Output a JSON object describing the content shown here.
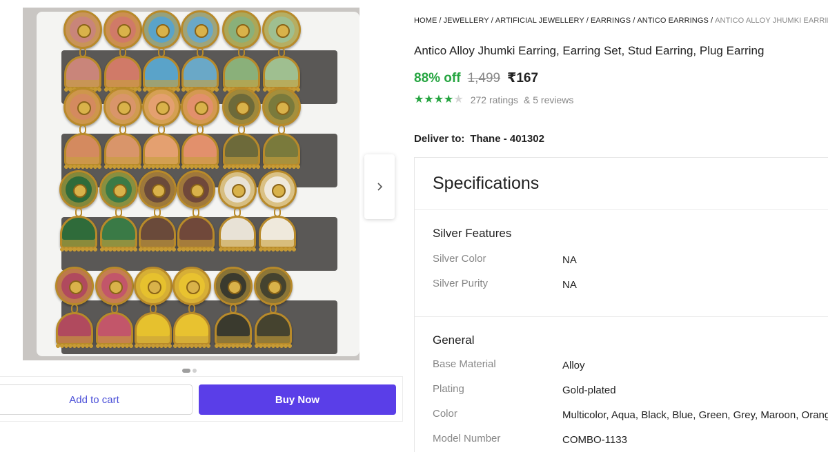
{
  "breadcrumb": {
    "items": [
      "HOME",
      "JEWELLERY",
      "ARTIFICIAL JEWELLERY",
      "EARRINGS",
      "ANTICO EARRINGS"
    ],
    "current": "ANTICO ALLOY JHUMKI EARRING, EA"
  },
  "product": {
    "title": "Antico Alloy Jhumki Earring, Earring Set, Stud Earring, Plug Earring",
    "discount": "88% off",
    "mrp": "1,499",
    "price": "₹167",
    "rating_stars": 4,
    "rating_max": 5,
    "ratings_count": "272 ratings",
    "reviews": "& 5 reviews"
  },
  "delivery": {
    "label": "Deliver to:",
    "location": "Thane - 401302"
  },
  "gallery": {
    "image_alt_icon": "product-image",
    "next_icon": "chevron-right-icon",
    "current_slide": 1,
    "total_slides": 2,
    "earring_colors": [
      [
        "#c9857a",
        "#d07a68",
        "#5aa3c9",
        "#6aa8c7",
        "#8ab07a",
        "#9fbf90"
      ],
      [
        "#d48a5f",
        "#d9956a",
        "#e4a070",
        "#e2906c",
        "#6d6a3a",
        "#7a7a3c"
      ],
      [
        "#2f6b3a",
        "#3a7a46",
        "#6a4a3a",
        "#70483a",
        "#e8e2d6",
        "#efe9dc"
      ],
      [
        "#b04a5e",
        "#c2566a",
        "#e6c12e",
        "#e8c230",
        "#3a3a2e",
        "#45432f"
      ]
    ]
  },
  "actions": {
    "add_to_cart": "Add to cart",
    "buy_now": "Buy Now"
  },
  "specifications": {
    "title": "Specifications",
    "sections": [
      {
        "name": "Silver Features",
        "rows": [
          {
            "key": "Silver Color",
            "value": "NA"
          },
          {
            "key": "Silver Purity",
            "value": "NA"
          }
        ]
      },
      {
        "name": "General",
        "rows": [
          {
            "key": "Base Material",
            "value": "Alloy"
          },
          {
            "key": "Plating",
            "value": "Gold-plated"
          },
          {
            "key": "Color",
            "value": "Multicolor, Aqua, Black, Blue, Green, Grey, Maroon, Orange,"
          },
          {
            "key": "Model Number",
            "value": "COMBO-1133"
          }
        ]
      }
    ]
  },
  "colors": {
    "accent": "#5a3ee8",
    "discount_green": "#26a541",
    "muted": "#878787"
  }
}
